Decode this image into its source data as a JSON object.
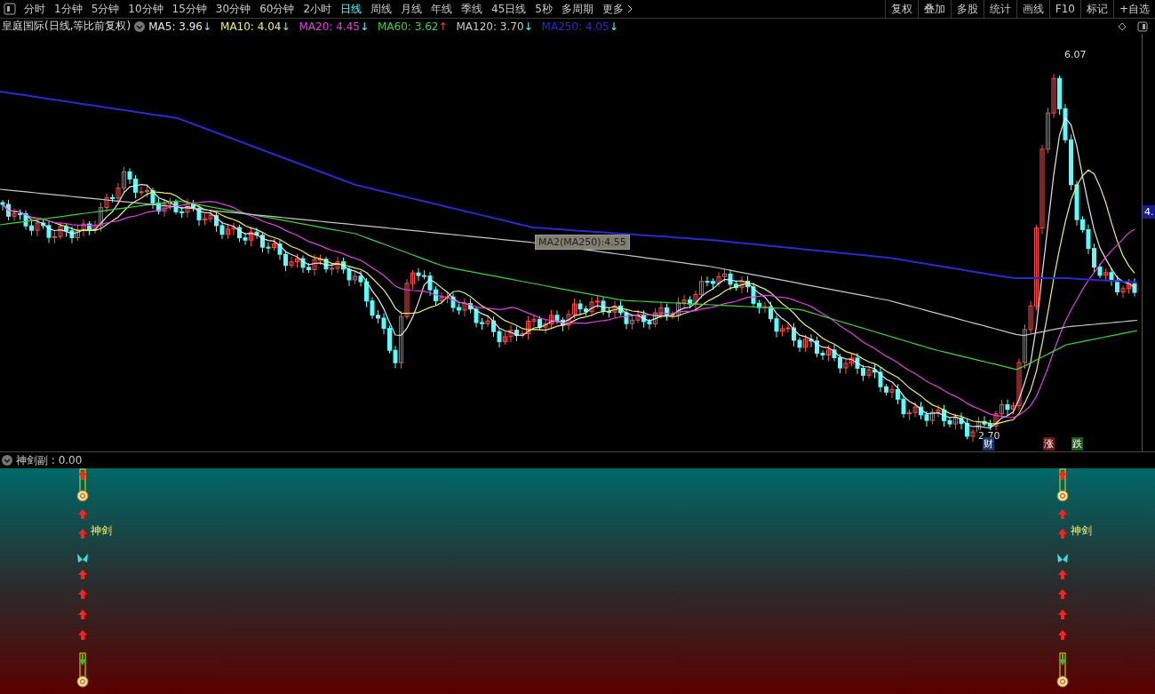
{
  "toolbar": {
    "periods": [
      {
        "label": "分时",
        "selected": false
      },
      {
        "label": "1分钟",
        "selected": false
      },
      {
        "label": "5分钟",
        "selected": false
      },
      {
        "label": "10分钟",
        "selected": false
      },
      {
        "label": "15分钟",
        "selected": false
      },
      {
        "label": "30分钟",
        "selected": false
      },
      {
        "label": "60分钟",
        "selected": false
      },
      {
        "label": "2小时",
        "selected": false
      },
      {
        "label": "日线",
        "selected": true
      },
      {
        "label": "周线",
        "selected": false
      },
      {
        "label": "月线",
        "selected": false
      },
      {
        "label": "年线",
        "selected": false
      },
      {
        "label": "季线",
        "selected": false
      },
      {
        "label": "45日线",
        "selected": false
      },
      {
        "label": "5秒",
        "selected": false
      },
      {
        "label": "多周期",
        "selected": false
      },
      {
        "label": "更多",
        "selected": false
      }
    ],
    "actions": [
      "复权",
      "叠加",
      "多股",
      "统计",
      "画线",
      "F10",
      "标记",
      "+自选"
    ]
  },
  "legend": {
    "title": "皇庭国际(日线,等比前复权)",
    "indicators": [
      {
        "label": "MA5: 3.96",
        "arrow": "↓",
        "rising": false,
        "color": "#e8e8e8"
      },
      {
        "label": "MA10: 4.04",
        "arrow": "↓",
        "rising": false,
        "color": "#f0f060"
      },
      {
        "label": "MA20: 4.45",
        "arrow": "↓",
        "rising": false,
        "color": "#e040e0"
      },
      {
        "label": "MA60: 3.62",
        "arrow": "↑",
        "rising": true,
        "color": "#40d040"
      },
      {
        "label": "MA120: 3.70",
        "arrow": "↓",
        "rising": false,
        "color": "#c8c8c8"
      },
      {
        "label": "MA250: 4.05",
        "arrow": "↓",
        "rising": false,
        "color": "#2a2ad0"
      }
    ]
  },
  "chart": {
    "high_label": "6.07",
    "low_label": "2.70",
    "tooltip": "MA2(MA250):4.55",
    "axis_label": "4.",
    "markers": [
      {
        "text": "财",
        "color": "#1c3768"
      },
      {
        "text": "涨",
        "color": "#6b1818"
      },
      {
        "text": "跌",
        "color": "#205a20"
      }
    ]
  },
  "sub_pane": {
    "title": "神剑副 : 0.00",
    "signals": [
      {
        "label": "神剑"
      },
      {
        "label": "神剑"
      }
    ]
  }
}
